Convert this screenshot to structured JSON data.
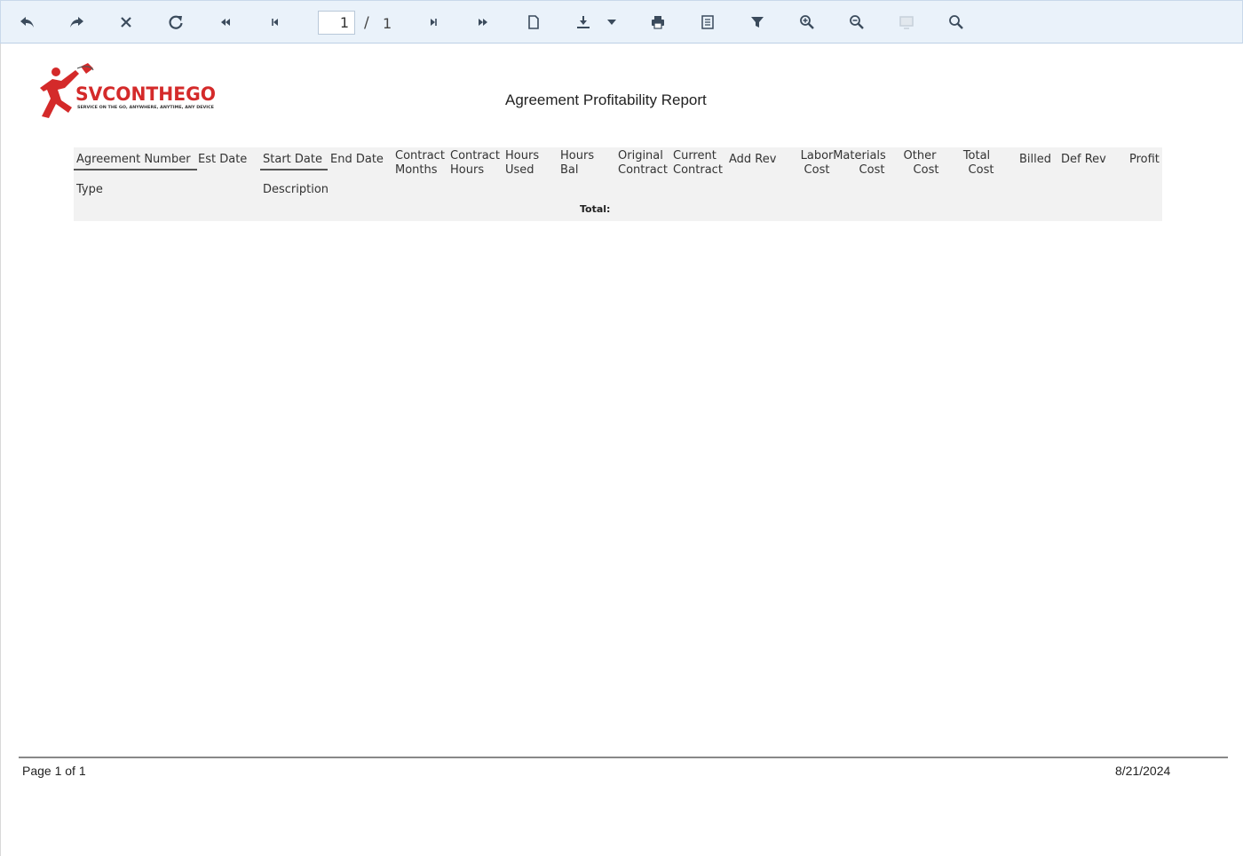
{
  "toolbar": {
    "page_current": "1",
    "page_separator": "/",
    "page_total": "1",
    "buttons": [
      "back-icon",
      "forward-icon",
      "close-icon",
      "refresh-icon",
      "first-page-icon",
      "previous-page-icon",
      "next-page-icon",
      "last-page-icon",
      "document-icon",
      "export-icon",
      "dropdown-caret-icon",
      "print-icon",
      "print-layout-icon",
      "filter-icon",
      "zoom-in-icon",
      "zoom-out-icon",
      "fit-page-icon",
      "search-icon"
    ],
    "icon_color": "#3b4b5c"
  },
  "report": {
    "logo_text": "SVCONTHEGO",
    "logo_tagline": "SERVICE ON THE GO, ANYWHERE, ANYTIME, ANY DEVICE",
    "logo_color": "#d42a2a",
    "title": "Agreement Profitability Report",
    "columns": {
      "agreement_number": "Agreement Number",
      "est_date": "Est Date",
      "start_date": "Start Date",
      "end_date": "End Date",
      "contract_months_1": "Contract",
      "contract_months_2": "Months",
      "contract_hours_1": "Contract",
      "contract_hours_2": "Hours",
      "hours_used_1": "Hours",
      "hours_used_2": "Used",
      "hours_bal_1": "Hours",
      "hours_bal_2": "Bal",
      "original_contract_1": "Original",
      "original_contract_2": "Contract",
      "current_contract_1": "Current",
      "current_contract_2": "Contract",
      "add_rev": "Add Rev",
      "labor_cost_1": "Labor",
      "labor_cost_2": "Cost",
      "materials_cost_1": "Materials",
      "materials_cost_2": "Cost",
      "other_cost_1": "Other",
      "other_cost_2": "Cost",
      "total_cost_1": "Total",
      "total_cost_2": "Cost",
      "billed": "Billed",
      "def_rev": "Def Rev",
      "profit": "Profit",
      "type": "Type",
      "description": "Description"
    },
    "total_label": "Total:",
    "footer_page": "Page 1 of 1",
    "footer_date": "8/21/2024"
  }
}
